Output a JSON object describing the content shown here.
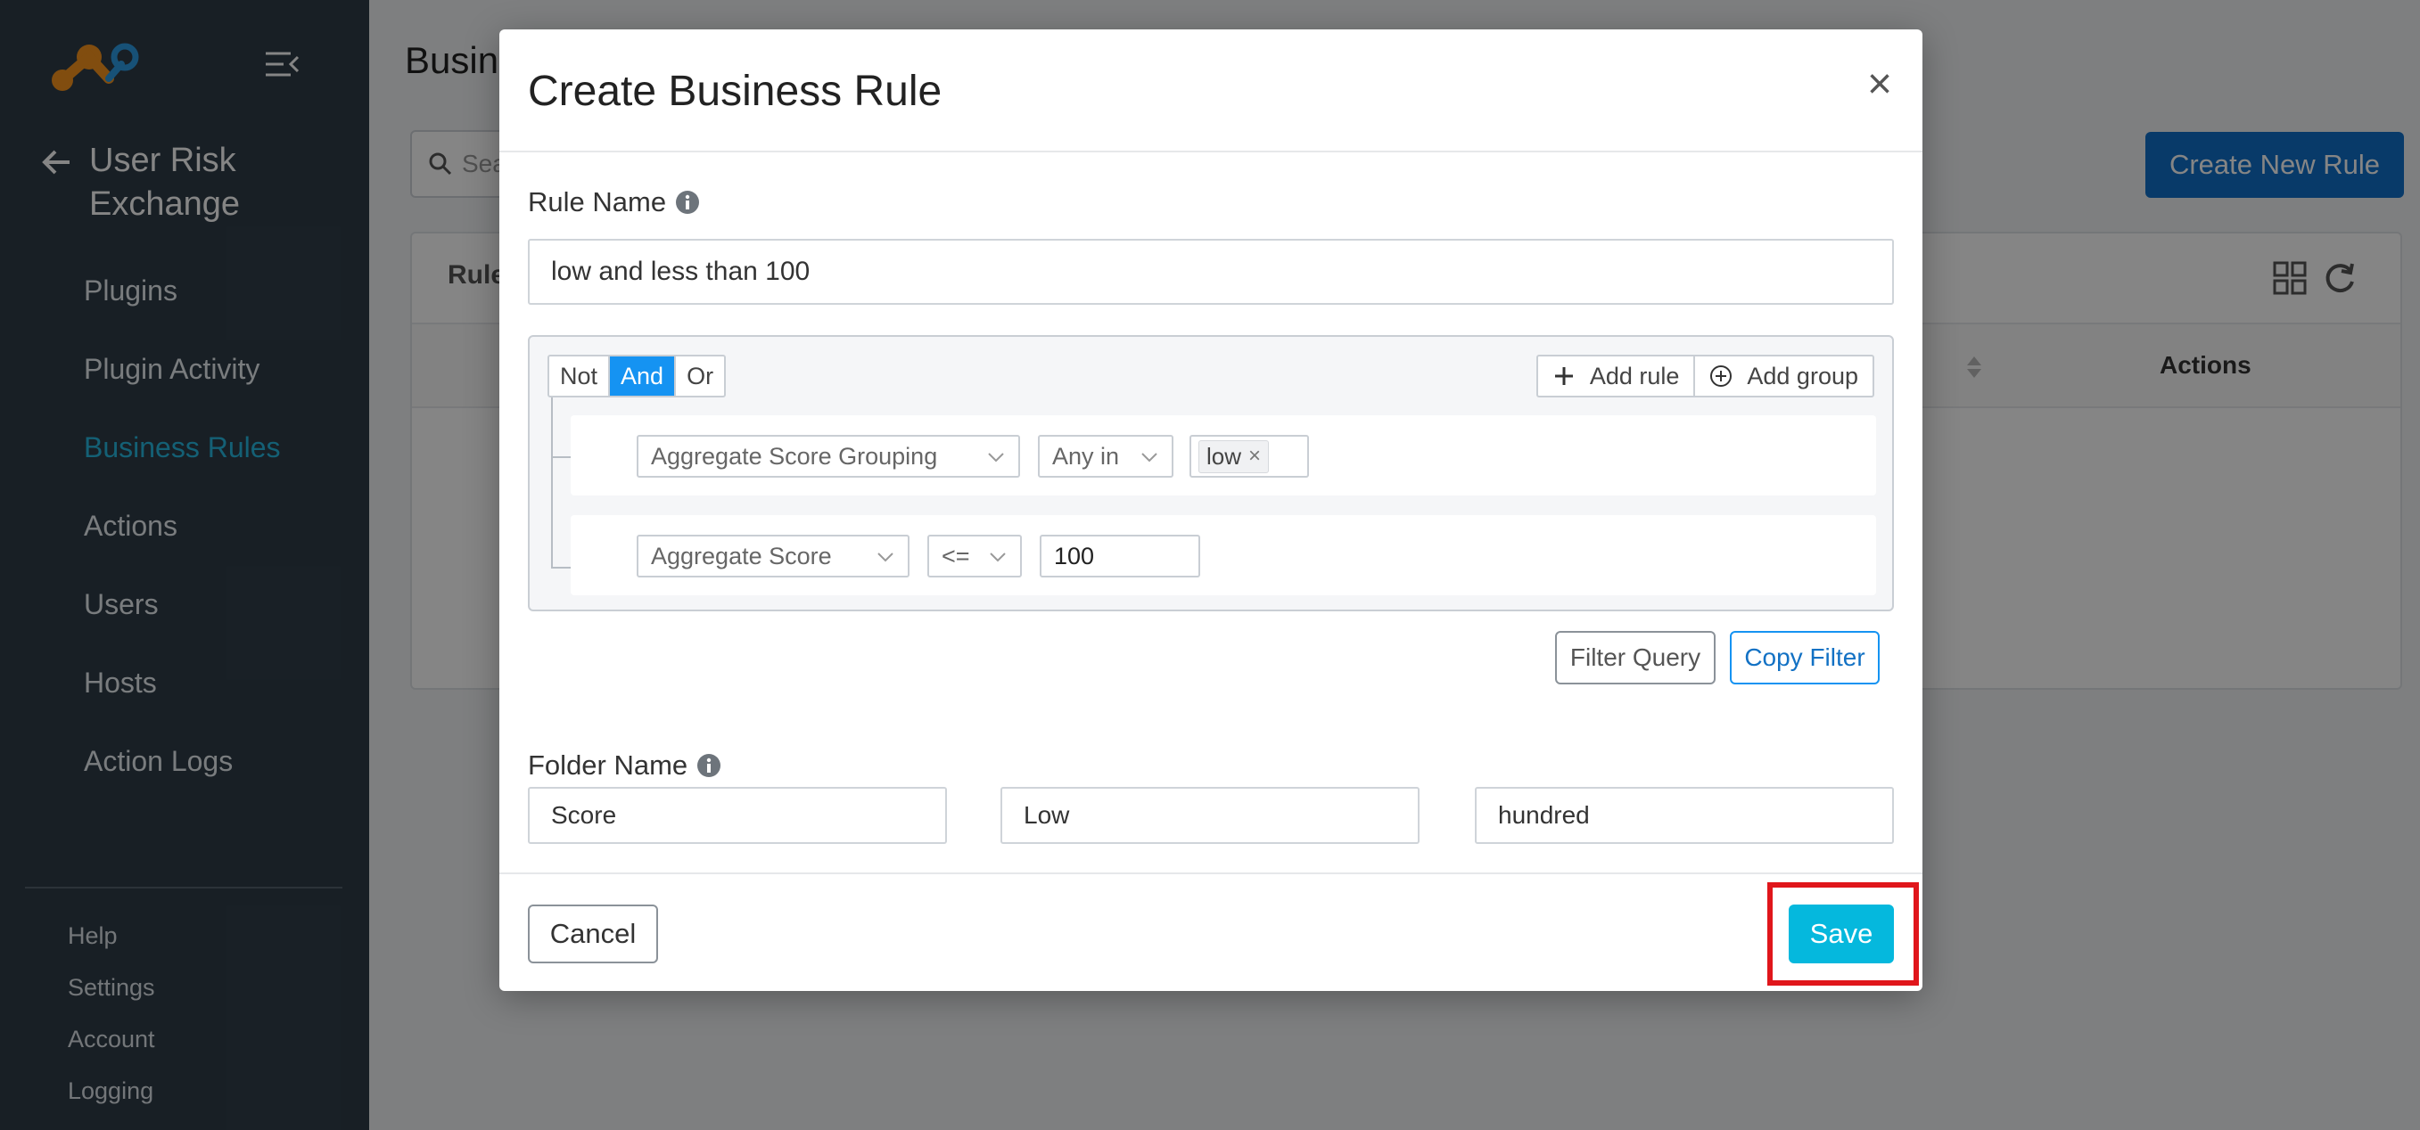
{
  "sidebar": {
    "app_title": "User Risk Exchange",
    "nav": [
      {
        "label": "Plugins"
      },
      {
        "label": "Plugin Activity"
      },
      {
        "label": "Business Rules"
      },
      {
        "label": "Actions"
      },
      {
        "label": "Users"
      },
      {
        "label": "Hosts"
      },
      {
        "label": "Action Logs"
      }
    ],
    "active_index": 2,
    "footer": [
      {
        "label": "Help"
      },
      {
        "label": "Settings"
      },
      {
        "label": "Account"
      },
      {
        "label": "Logging"
      }
    ]
  },
  "page": {
    "title": "Busin",
    "search_placeholder": "Sea",
    "create_button": "Create New Rule",
    "table_header_label": "Rule",
    "column_actions": "Actions"
  },
  "modal": {
    "title": "Create Business Rule",
    "close": "×",
    "rule_name_label": "Rule Name",
    "rule_name_value": "low and less than 100",
    "query": {
      "conjunctions": [
        "Not",
        "And",
        "Or"
      ],
      "selected_conjunction": "And",
      "add_rule": "Add rule",
      "add_group": "Add group",
      "rules": [
        {
          "field": "Aggregate Score Grouping",
          "operator": "Any in",
          "values": [
            "low"
          ]
        },
        {
          "field": "Aggregate Score",
          "operator": "<=",
          "value": "100"
        }
      ]
    },
    "filter_query_button": "Filter Query",
    "copy_filter_button": "Copy Filter",
    "folder_name_label": "Folder Name",
    "folder_values": [
      "Score",
      "Low",
      "hundred"
    ],
    "cancel_button": "Cancel",
    "save_button": "Save"
  },
  "colors": {
    "sidebar_bg": "#2f3d48",
    "active_nav": "#27b8e1",
    "primary_button": "#1170c9",
    "save_button": "#05b8dd",
    "highlight_box": "#e0161b",
    "conjunction_selected": "#1593f2"
  }
}
